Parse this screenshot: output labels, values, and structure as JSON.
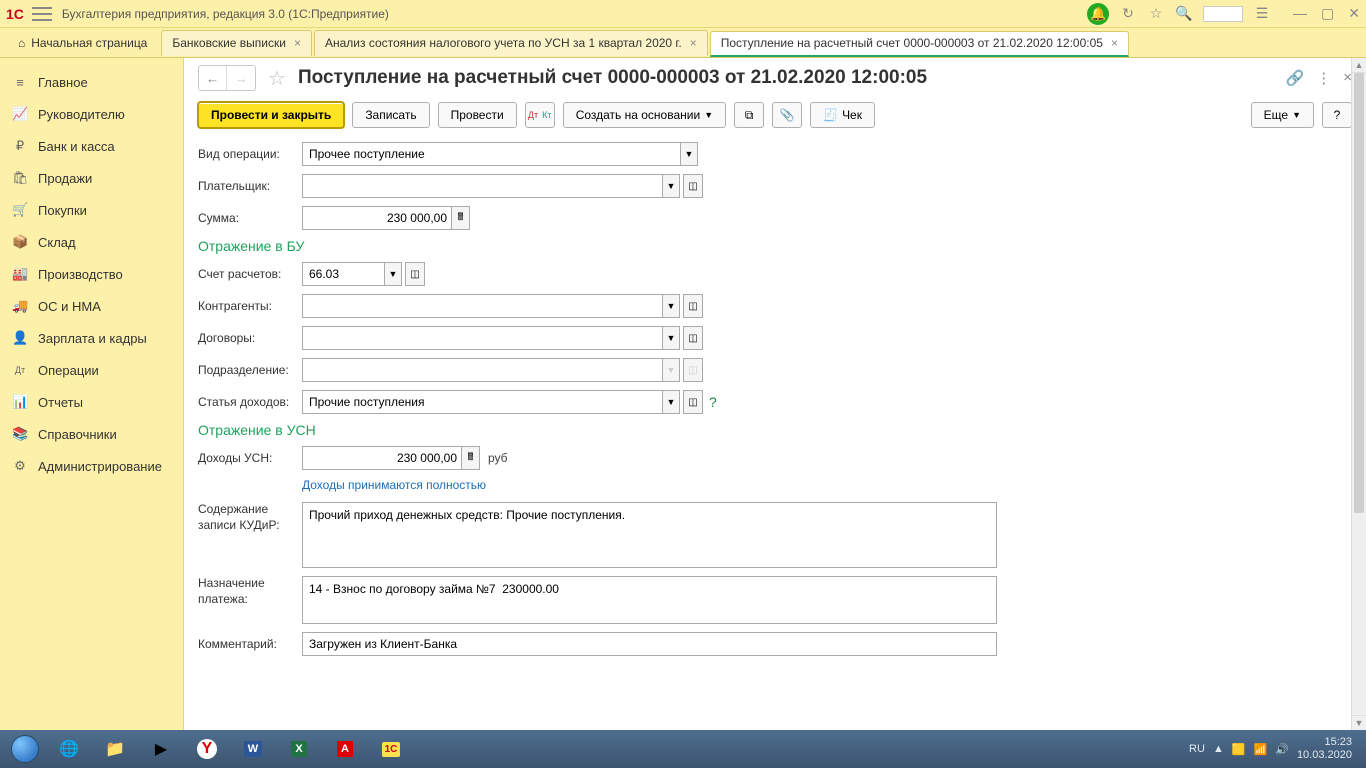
{
  "titlebar": {
    "app_title": "Бухгалтерия предприятия, редакция 3.0  (1С:Предприятие)"
  },
  "tabs": {
    "start": "Начальная страница",
    "t1": "Банковские выписки",
    "t2": "Анализ состояния налогового учета по УСН за 1 квартал 2020 г.",
    "t3": "Поступление на расчетный счет 0000-000003 от 21.02.2020 12:00:05"
  },
  "sidebar": [
    {
      "icon": "≡",
      "label": "Главное"
    },
    {
      "icon": "📈",
      "label": "Руководителю"
    },
    {
      "icon": "₽",
      "label": "Банк и касса"
    },
    {
      "icon": "🛍",
      "label": "Продажи"
    },
    {
      "icon": "🛒",
      "label": "Покупки"
    },
    {
      "icon": "📦",
      "label": "Склад"
    },
    {
      "icon": "🏭",
      "label": "Производство"
    },
    {
      "icon": "🚚",
      "label": "ОС и НМА"
    },
    {
      "icon": "👤",
      "label": "Зарплата и кадры"
    },
    {
      "icon": "Дт",
      "label": "Операции"
    },
    {
      "icon": "📊",
      "label": "Отчеты"
    },
    {
      "icon": "📚",
      "label": "Справочники"
    },
    {
      "icon": "⚙",
      "label": "Администрирование"
    }
  ],
  "doc": {
    "title": "Поступление на расчетный счет 0000-000003 от 21.02.2020 12:00:05",
    "toolbar": {
      "post_close": "Провести и закрыть",
      "write": "Записать",
      "post": "Провести",
      "createbased": "Создать на основании",
      "check": "Чек",
      "more": "Еще"
    },
    "labels": {
      "op_type": "Вид операции:",
      "payer": "Плательщик:",
      "sum": "Сумма:",
      "sec_bu": "Отражение в БУ",
      "acc": "Счет расчетов:",
      "contr": "Контрагенты:",
      "contracts": "Договоры:",
      "dept": "Подразделение:",
      "income_item": "Статья доходов:",
      "sec_usn": "Отражение в УСН",
      "income_usn": "Доходы УСН:",
      "curr": "руб",
      "income_full": "Доходы принимаются полностью",
      "kudir": "Содержание записи КУДиР:",
      "purpose": "Назначение платежа:",
      "comment": "Комментарий:"
    },
    "values": {
      "op_type": "Прочее поступление",
      "payer": "",
      "sum": "230 000,00",
      "acc": "66.03",
      "contr": "",
      "contracts": "",
      "dept": "",
      "income_item": "Прочие поступления",
      "income_usn": "230 000,00",
      "kudir": "Прочий приход денежных средств: Прочие поступления.",
      "purpose": "14 - Взнос по договору займа №7  230000.00",
      "comment": "Загружен из Клиент-Банка"
    }
  },
  "system": {
    "lang": "RU",
    "time": "15:23",
    "date": "10.03.2020"
  }
}
